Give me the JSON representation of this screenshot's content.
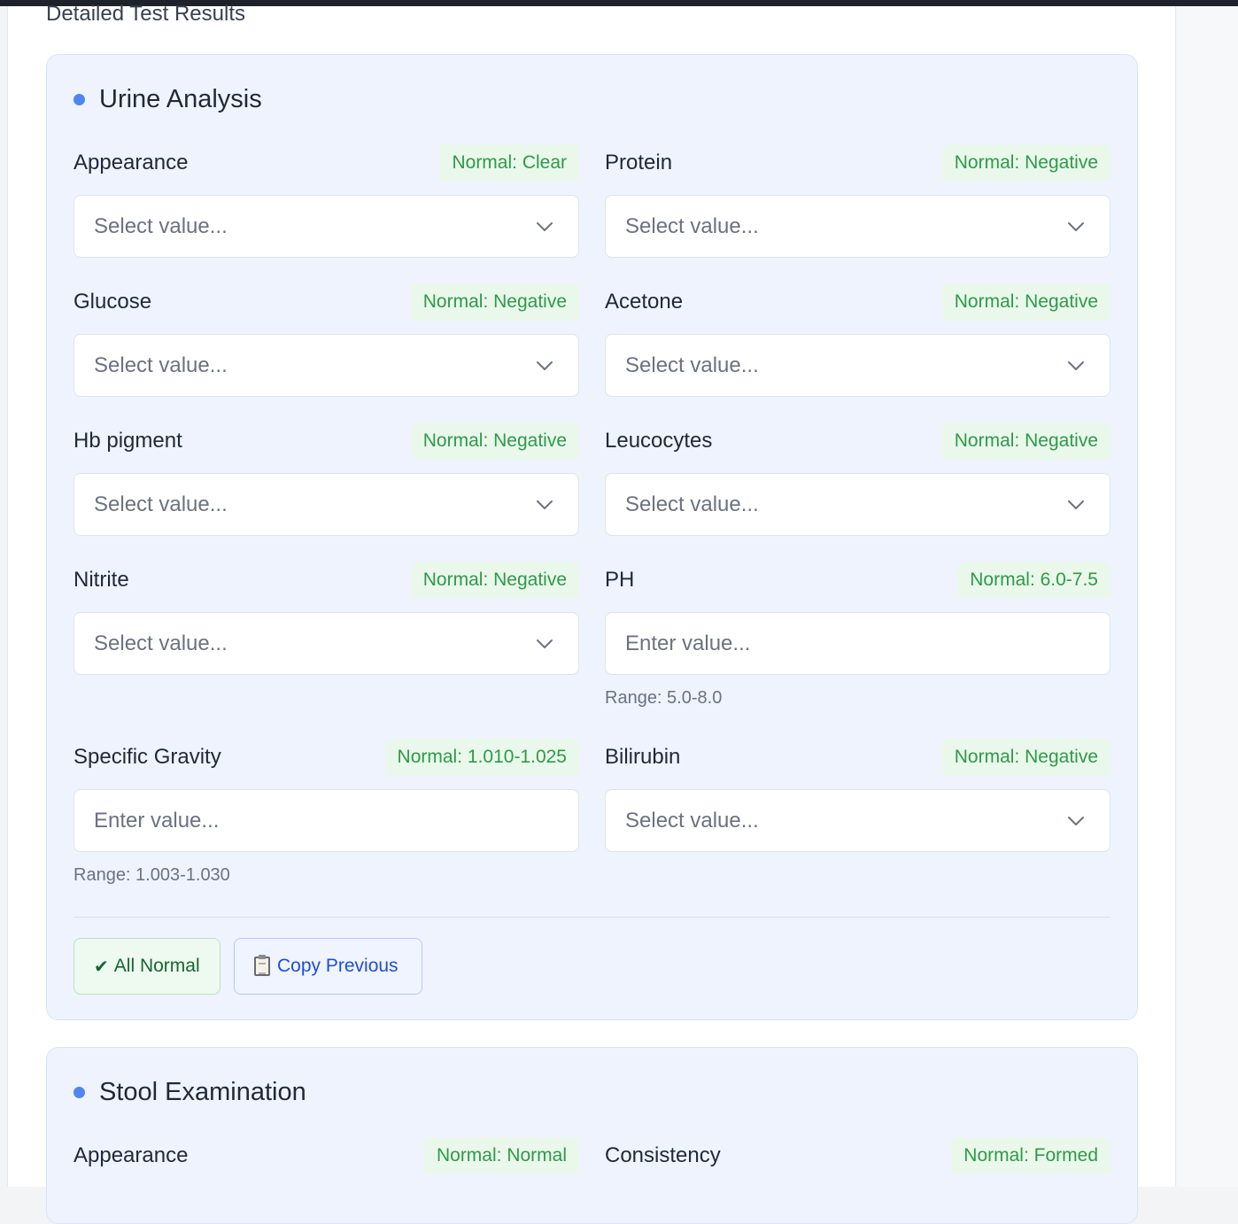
{
  "page": {
    "title": "Detailed Test Results"
  },
  "urine": {
    "title": "Urine Analysis",
    "fields": [
      {
        "label": "Appearance",
        "normal": "Normal: Clear",
        "type": "select",
        "placeholder": "Select value..."
      },
      {
        "label": "Protein",
        "normal": "Normal: Negative",
        "type": "select",
        "placeholder": "Select value..."
      },
      {
        "label": "Glucose",
        "normal": "Normal: Negative",
        "type": "select",
        "placeholder": "Select value..."
      },
      {
        "label": "Acetone",
        "normal": "Normal: Negative",
        "type": "select",
        "placeholder": "Select value..."
      },
      {
        "label": "Hb pigment",
        "normal": "Normal: Negative",
        "type": "select",
        "placeholder": "Select value..."
      },
      {
        "label": "Leucocytes",
        "normal": "Normal: Negative",
        "type": "select",
        "placeholder": "Select value..."
      },
      {
        "label": "Nitrite",
        "normal": "Normal: Negative",
        "type": "select",
        "placeholder": "Select value..."
      },
      {
        "label": "PH",
        "normal": "Normal: 6.0-7.5",
        "type": "input",
        "placeholder": "Enter value...",
        "range": "Range: 5.0-8.0"
      },
      {
        "label": "Specific Gravity",
        "normal": "Normal: 1.010-1.025",
        "type": "input",
        "placeholder": "Enter value...",
        "range": "Range: 1.003-1.030"
      },
      {
        "label": "Bilirubin",
        "normal": "Normal: Negative",
        "type": "select",
        "placeholder": "Select value..."
      }
    ],
    "actions": {
      "all_normal_icon": "✔",
      "all_normal": "All Normal",
      "copy_previous_icon": "clipboard-icon",
      "copy_previous": "Copy Previous"
    }
  },
  "stool": {
    "title": "Stool Examination",
    "fields": [
      {
        "label": "Appearance",
        "normal": "Normal: Normal"
      },
      {
        "label": "Consistency",
        "normal": "Normal: Formed"
      }
    ]
  },
  "colors": {
    "accent_dot": "#4f86f2",
    "badge_bg": "#eaf8ec",
    "badge_text": "#2e9a48",
    "section_bg": "#eef3fe"
  }
}
